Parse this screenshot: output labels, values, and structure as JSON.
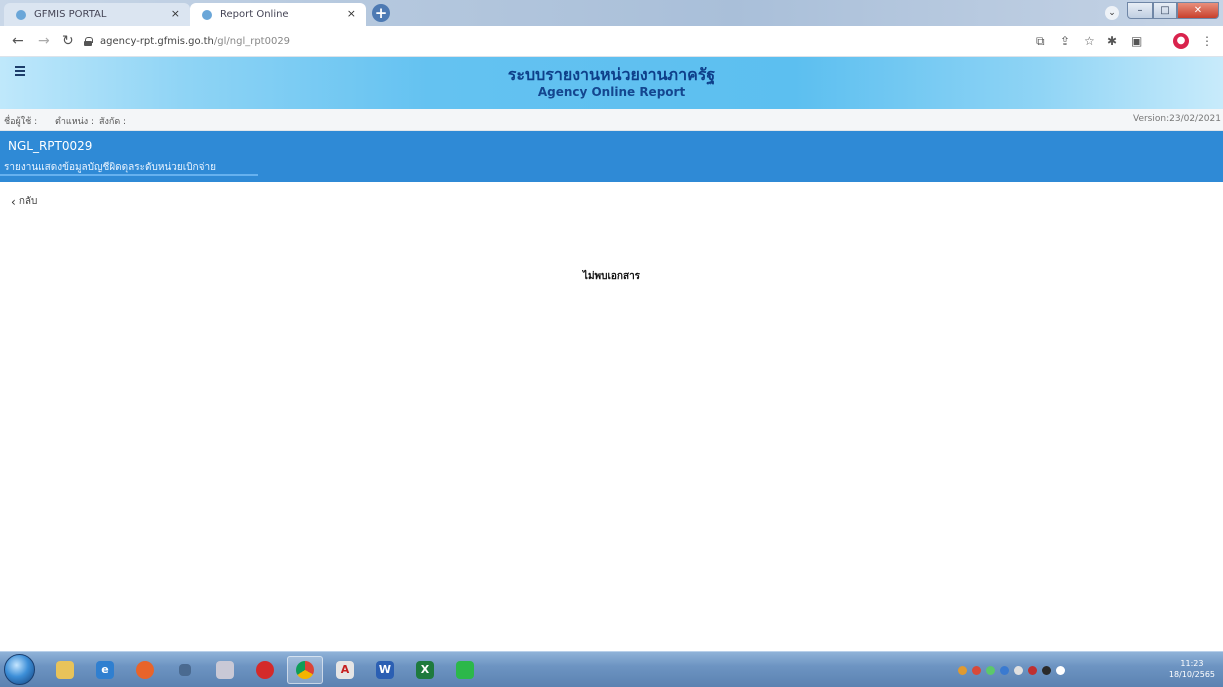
{
  "browser": {
    "tabs": [
      {
        "title": "GFMIS PORTAL",
        "active": false
      },
      {
        "title": "Report Online",
        "active": true
      }
    ],
    "tab_close_glyph": "×",
    "new_tab_glyph": "+",
    "url": {
      "host": "agency-rpt.gfmis.go.th",
      "path": "/gl/ngl_rpt0029"
    },
    "nav_icons": [
      "back-arrow-icon",
      "forward-arrow-icon",
      "reload-icon"
    ],
    "toolbar_icons": [
      "translate-icon",
      "share-icon",
      "bookmark-star-icon",
      "extensions-icon",
      "side-panel-icon",
      "profile-icon",
      "more-icon"
    ]
  },
  "site": {
    "title": "ระบบรายงานหน่วยงานภาครัฐ",
    "subtitle": "Agency Online Report"
  },
  "user_bar": {
    "user_label": "ชื่อผู้ใช้ :",
    "position_label": "ตำแหน่ง :",
    "affiliation_label": "สังกัด :",
    "version": "Version:23/02/2021"
  },
  "report": {
    "code": "NGL_RPT0029",
    "name": "รายงานแสดงข้อมูลบัญชีผิดดุลระดับหน่วยเบิกจ่าย"
  },
  "back_link": {
    "label": "กลับ"
  },
  "main": {
    "empty_message": "ไม่พบเอกสาร"
  },
  "taskbar": {
    "apps": [
      "windows-explorer",
      "internet-explorer",
      "firefox",
      "window-app",
      "paint",
      "opera",
      "chrome",
      "acrobat",
      "word",
      "excel",
      "line"
    ],
    "clock_time": "11:23",
    "clock_date": "18/10/2565"
  },
  "colors": {
    "banner": "#2f8ad6",
    "header_title": "#0e3f8a"
  }
}
